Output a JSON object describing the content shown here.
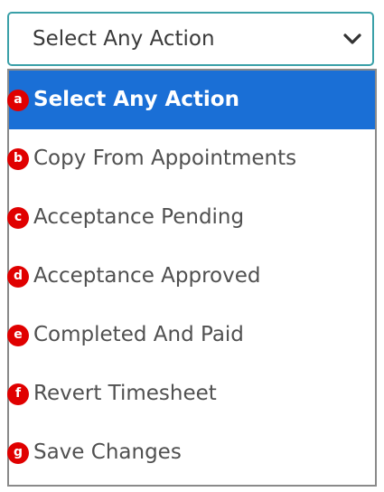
{
  "select": {
    "value": "Select Any Action",
    "icon": "chevron-down-icon",
    "border_color": "#3aa0a8"
  },
  "dropdown": {
    "selected_background": "#1a6fd6",
    "badge_color": "#e00000",
    "options": [
      {
        "badge": "a",
        "label": "Select Any Action",
        "selected": true
      },
      {
        "badge": "b",
        "label": "Copy From Appointments",
        "selected": false
      },
      {
        "badge": "c",
        "label": "Acceptance Pending",
        "selected": false
      },
      {
        "badge": "d",
        "label": "Acceptance Approved",
        "selected": false
      },
      {
        "badge": "e",
        "label": "Completed And Paid",
        "selected": false
      },
      {
        "badge": "f",
        "label": "Revert Timesheet",
        "selected": false
      },
      {
        "badge": "g",
        "label": "Save Changes",
        "selected": false
      }
    ]
  }
}
